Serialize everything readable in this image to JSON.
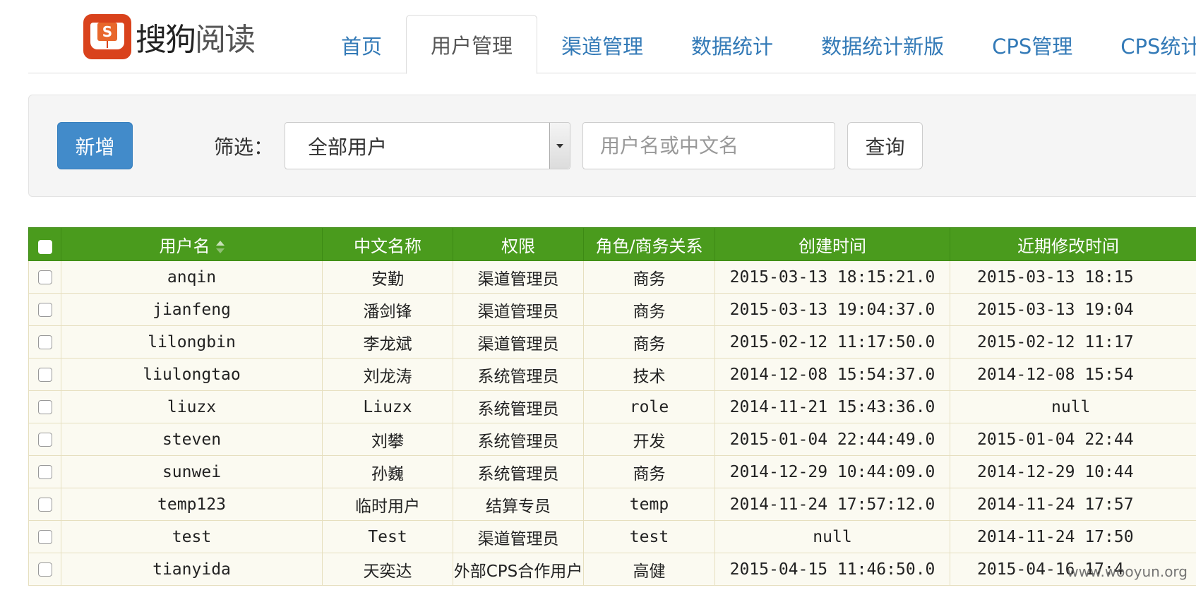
{
  "brand": {
    "name_part1": "搜狗",
    "name_part2": "阅读",
    "logo_letter": "S"
  },
  "nav": {
    "tabs": [
      {
        "label": "首页",
        "active": false
      },
      {
        "label": "用户管理",
        "active": true
      },
      {
        "label": "渠道管理",
        "active": false
      },
      {
        "label": "数据统计",
        "active": false
      },
      {
        "label": "数据统计新版",
        "active": false
      },
      {
        "label": "CPS管理",
        "active": false
      },
      {
        "label": "CPS统计",
        "active": false
      }
    ]
  },
  "toolbar": {
    "add_label": "新增",
    "filter_label": "筛选：",
    "filter_selected": "全部用户",
    "search_placeholder": "用户名或中文名",
    "query_label": "查询"
  },
  "table": {
    "headers": [
      "用户名",
      "中文名称",
      "权限",
      "角色/商务关系",
      "创建时间",
      "近期修改时间"
    ],
    "rows": [
      {
        "username": "anqin",
        "cn_name": "安勤",
        "permission": "渠道管理员",
        "role": "商务",
        "created": "2015-03-13 18:15:21.0",
        "modified": "2015-03-13 18:15"
      },
      {
        "username": "jianfeng",
        "cn_name": "潘剑锋",
        "permission": "渠道管理员",
        "role": "商务",
        "created": "2015-03-13 19:04:37.0",
        "modified": "2015-03-13 19:04"
      },
      {
        "username": "lilongbin",
        "cn_name": "李龙斌",
        "permission": "渠道管理员",
        "role": "商务",
        "created": "2015-02-12 11:17:50.0",
        "modified": "2015-02-12 11:17"
      },
      {
        "username": "liulongtao",
        "cn_name": "刘龙涛",
        "permission": "系统管理员",
        "role": "技术",
        "created": "2014-12-08 15:54:37.0",
        "modified": "2014-12-08 15:54"
      },
      {
        "username": "liuzx",
        "cn_name": "Liuzx",
        "permission": "系统管理员",
        "role": "role",
        "created": "2014-11-21 15:43:36.0",
        "modified": "null"
      },
      {
        "username": "steven",
        "cn_name": "刘攀",
        "permission": "系统管理员",
        "role": "开发",
        "created": "2015-01-04 22:44:49.0",
        "modified": "2015-01-04 22:44"
      },
      {
        "username": "sunwei",
        "cn_name": "孙巍",
        "permission": "系统管理员",
        "role": "商务",
        "created": "2014-12-29 10:44:09.0",
        "modified": "2014-12-29 10:44"
      },
      {
        "username": "temp123",
        "cn_name": "临时用户",
        "permission": "结算专员",
        "role": "temp",
        "created": "2014-11-24 17:57:12.0",
        "modified": "2014-11-24 17:57"
      },
      {
        "username": "test",
        "cn_name": "Test",
        "permission": "渠道管理员",
        "role": "test",
        "created": "null",
        "modified": "2014-11-24 17:50"
      },
      {
        "username": "tianyida",
        "cn_name": "天奕达",
        "permission": "外部CPS合作用户",
        "role": "高健",
        "created": "2015-04-15 11:46:50.0",
        "modified": "2015-04-16 17:4"
      }
    ]
  },
  "watermark": "www.wooyun.org"
}
